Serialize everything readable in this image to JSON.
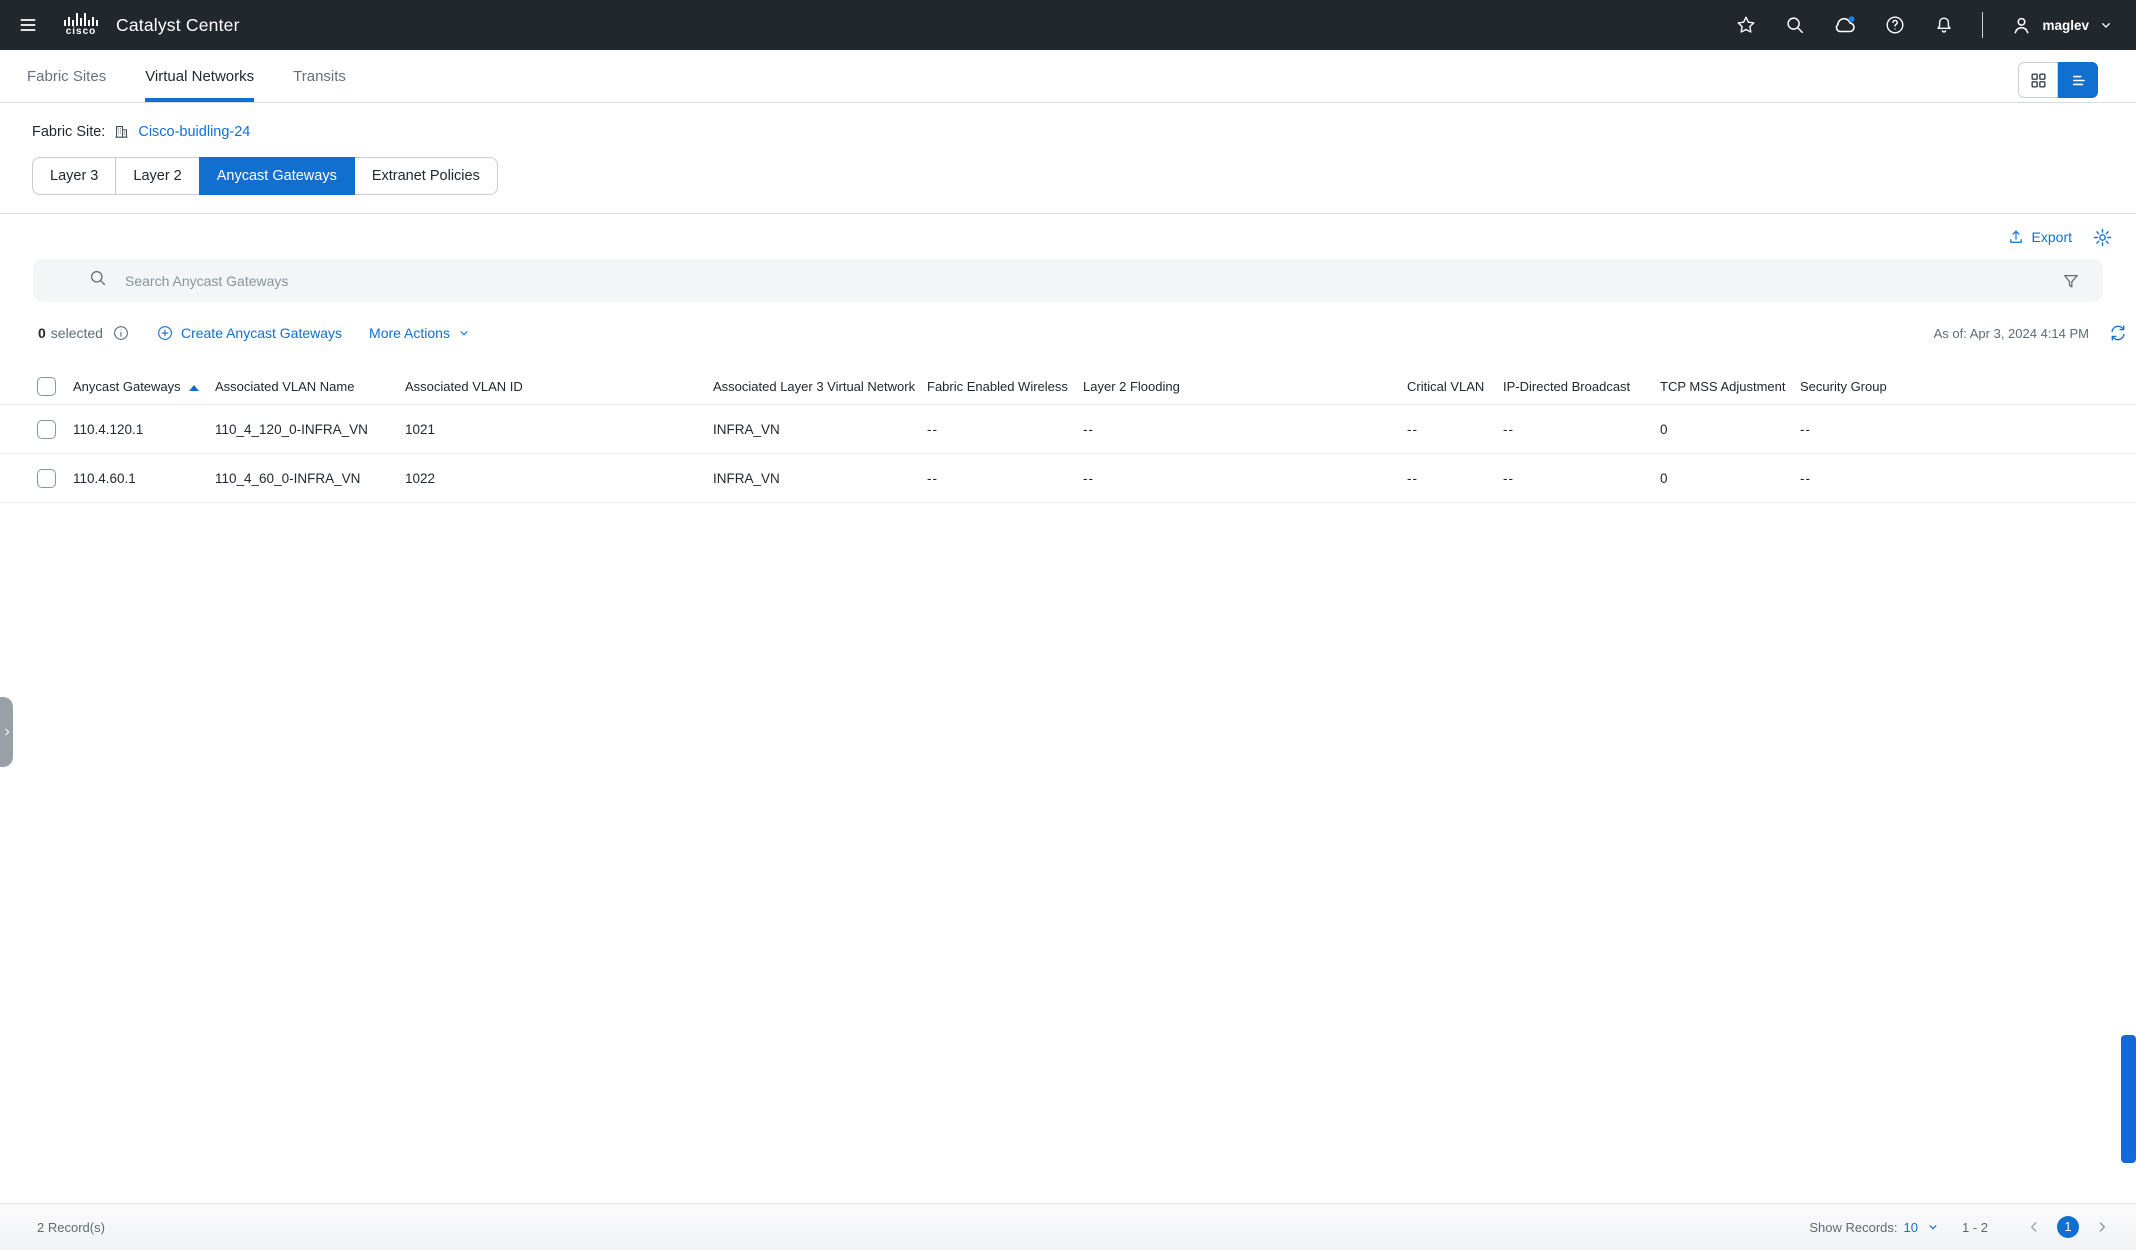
{
  "header": {
    "title": "Catalyst Center",
    "brand": "cisco",
    "user": "maglev"
  },
  "nav_tabs": [
    {
      "label": "Fabric Sites",
      "active": false
    },
    {
      "label": "Virtual Networks",
      "active": true
    },
    {
      "label": "Transits",
      "active": false
    }
  ],
  "fabric_site": {
    "label": "Fabric Site:",
    "name": "Cisco-buidling-24"
  },
  "layer_tabs": [
    {
      "label": "Layer 3",
      "active": false
    },
    {
      "label": "Layer 2",
      "active": false
    },
    {
      "label": "Anycast Gateways",
      "active": true
    },
    {
      "label": "Extranet Policies",
      "active": false
    }
  ],
  "toolbar": {
    "export_label": "Export"
  },
  "search": {
    "placeholder": "Search Anycast Gateways"
  },
  "actions": {
    "selected_count": "0",
    "selected_label": "selected",
    "create_label": "Create Anycast Gateways",
    "more_actions_label": "More Actions",
    "as_of": "As of: Apr 3, 2024 4:14 PM"
  },
  "table": {
    "columns": [
      "Anycast Gateways",
      "Associated VLAN Name",
      "Associated VLAN ID",
      "Associated Layer 3 Virtual Network",
      "Fabric Enabled Wireless",
      "Layer 2 Flooding",
      "Critical VLAN",
      "IP-Directed Broadcast",
      "TCP MSS Adjustment",
      "Security Group"
    ],
    "rows": [
      {
        "gateway": "110.4.120.1",
        "vlan_name": "110_4_120_0-INFRA_VN",
        "vlan_id": "1021",
        "l3_vn": "INFRA_VN",
        "fabric_wireless": "--",
        "l2_flooding": "--",
        "critical_vlan": "--",
        "ip_broadcast": "--",
        "tcp_mss": "0",
        "security_group": "--"
      },
      {
        "gateway": "110.4.60.1",
        "vlan_name": "110_4_60_0-INFRA_VN",
        "vlan_id": "1022",
        "l3_vn": "INFRA_VN",
        "fabric_wireless": "--",
        "l2_flooding": "--",
        "critical_vlan": "--",
        "ip_broadcast": "--",
        "tcp_mss": "0",
        "security_group": "--"
      }
    ]
  },
  "footer": {
    "records": "2 Record(s)",
    "show_records_label": "Show Records:",
    "page_size": "10",
    "range": "1 - 2",
    "current_page": "1"
  },
  "colors": {
    "accent": "#1170cf",
    "header_bg": "#22272c",
    "dash_blue": "#4f7fbf",
    "scrollbar_blue": "#1468d8"
  },
  "icons": {
    "menu": "≡",
    "star": "☆",
    "search": "⌕",
    "cloud": "☁",
    "help": "?",
    "bell": "🔔",
    "user": "👤",
    "chevron-down": "⌄",
    "building": "🏢",
    "export": "↥",
    "gear": "⚙",
    "filter": "▽",
    "info": "ⓘ",
    "plus-circle": "⊕",
    "refresh": "⟳",
    "sort-ascending": "▲",
    "grid-view": "▦",
    "list-view": "≣",
    "chevron-left": "‹",
    "chevron-right": "›"
  }
}
